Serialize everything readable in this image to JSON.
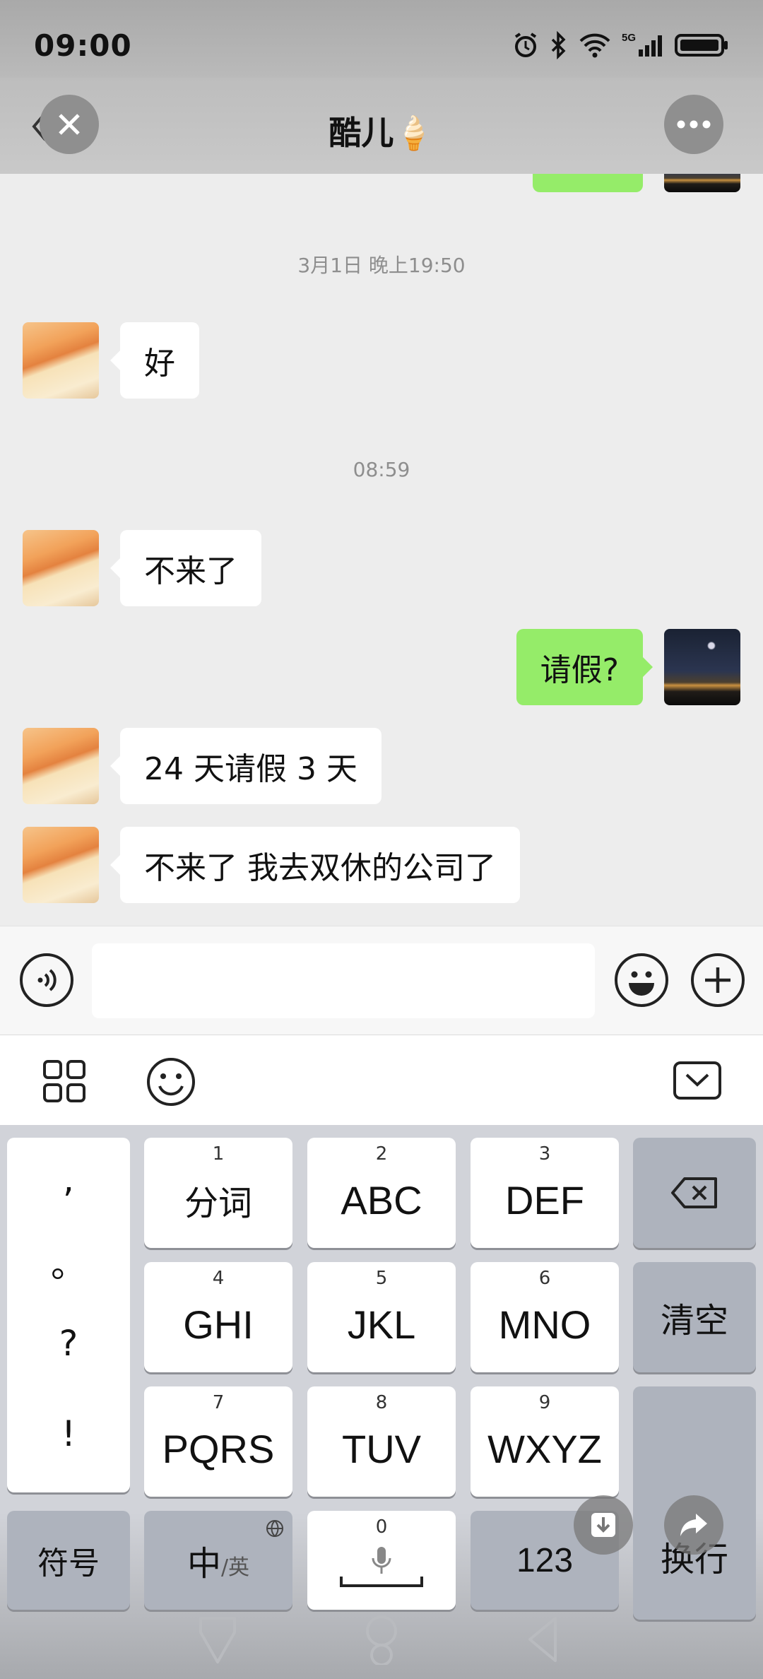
{
  "status_bar": {
    "time": "09:00"
  },
  "header": {
    "title": "酷儿🍦"
  },
  "chat": {
    "timestamps": [
      "3月1日 晚上19:50",
      "08:59"
    ],
    "messages": [
      {
        "side": "left",
        "text": "好"
      },
      {
        "side": "left",
        "text": "不来了"
      },
      {
        "side": "right",
        "text": "请假?"
      },
      {
        "side": "left",
        "text": "24 天请假 3 天"
      },
      {
        "side": "left",
        "text": "不来了 我去双休的公司了"
      }
    ]
  },
  "input_bar": {
    "placeholder": ""
  },
  "keyboard": {
    "punctuation": [
      ",",
      "。",
      "?",
      "!"
    ],
    "keys": [
      {
        "num": "1",
        "label": "分词"
      },
      {
        "num": "2",
        "label": "ABC"
      },
      {
        "num": "3",
        "label": "DEF"
      },
      {
        "num": "4",
        "label": "GHI"
      },
      {
        "num": "5",
        "label": "JKL"
      },
      {
        "num": "6",
        "label": "MNO"
      },
      {
        "num": "7",
        "label": "PQRS"
      },
      {
        "num": "8",
        "label": "TUV"
      },
      {
        "num": "9",
        "label": "WXYZ"
      }
    ],
    "clear_label": "清空",
    "enter_label": "换行",
    "symbol_label": "符号",
    "lang_main": "中",
    "lang_alt": "/英",
    "space_num": "0",
    "num_label": "123"
  },
  "colors": {
    "sent_bubble": "#95ec69",
    "received_bubble": "#ffffff",
    "chat_bg": "#ededed"
  }
}
